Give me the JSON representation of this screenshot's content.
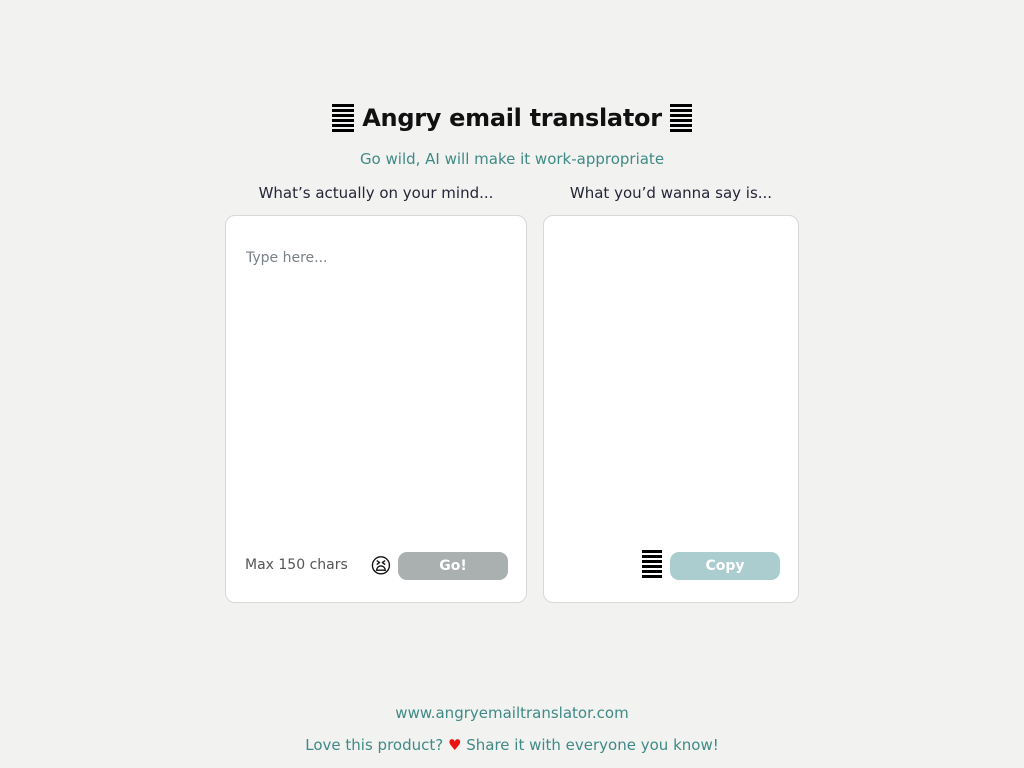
{
  "header": {
    "title": "Angry email translator",
    "subtitle": "Go wild, AI will make it work-appropriate"
  },
  "input_panel": {
    "label": "What’s actually on your mind...",
    "placeholder": "Type here...",
    "value": "",
    "max_chars_label": "Max 150 chars",
    "face_emoji": "😫",
    "go_label": "Go!"
  },
  "output_panel": {
    "label": "What you’d wanna say is...",
    "output_text": "",
    "copy_label": "Copy"
  },
  "footer": {
    "url": "www.angryemailtranslator.com",
    "share_before": "Love this product?",
    "heart": "♥",
    "share_after": "Share it with everyone you know!"
  },
  "colors": {
    "accent": "#3f8a86",
    "go_button": "#aab0b0",
    "copy_button": "#abcdcf",
    "heart": "#e11111"
  },
  "icons": {
    "title_decoration": "stacked-lines-icon",
    "copy_decoration": "stacked-lines-icon",
    "heart": "heart-icon",
    "face": "tired-face-icon"
  }
}
